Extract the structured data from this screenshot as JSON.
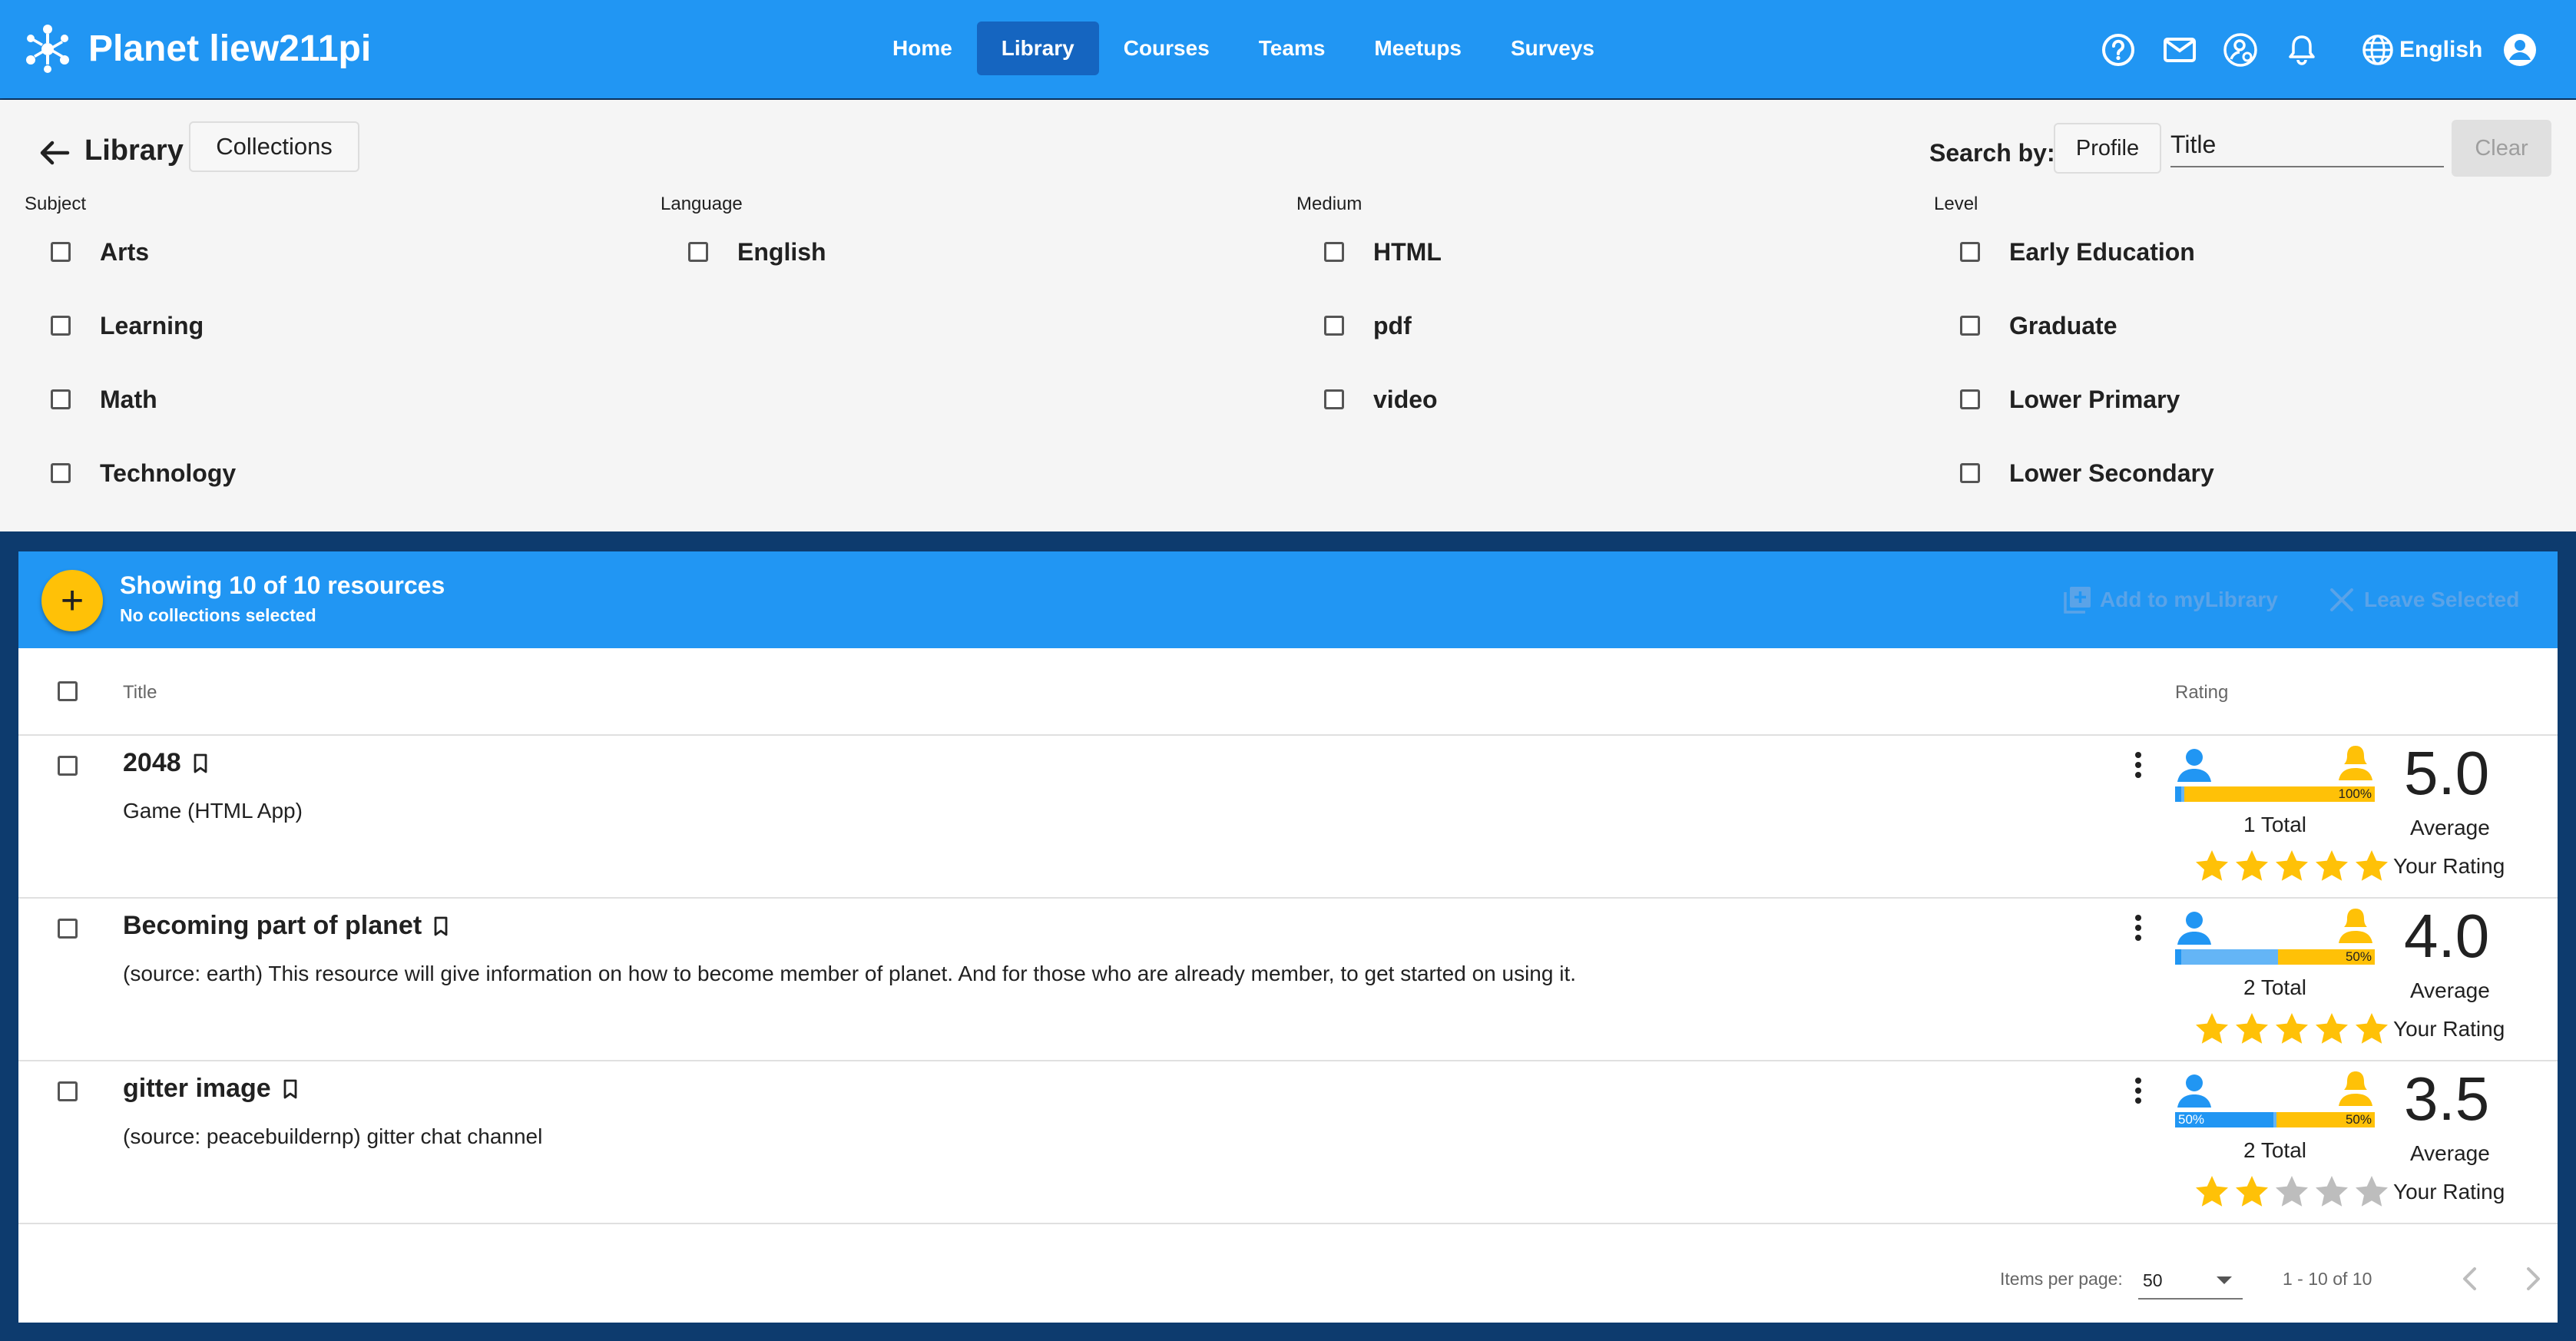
{
  "app": {
    "brand": "Planet liew211pi",
    "nav": [
      {
        "label": "Home",
        "active": false
      },
      {
        "label": "Library",
        "active": true
      },
      {
        "label": "Courses",
        "active": false
      },
      {
        "label": "Teams",
        "active": false
      },
      {
        "label": "Meetups",
        "active": false
      },
      {
        "label": "Surveys",
        "active": false
      }
    ],
    "language": "English",
    "icons": [
      "help-icon",
      "mail-icon",
      "user-settings-icon",
      "bell-icon",
      "globe-icon",
      "account-icon"
    ]
  },
  "library": {
    "title": "Library",
    "collections_button": "Collections",
    "search_by_label": "Search by:",
    "profile_button": "Profile",
    "search_placeholder": "Title",
    "clear_button": "Clear"
  },
  "filters": {
    "subject": {
      "label": "Subject",
      "options": [
        "Arts",
        "Learning",
        "Math",
        "Technology"
      ]
    },
    "language": {
      "label": "Language",
      "options": [
        "English"
      ]
    },
    "medium": {
      "label": "Medium",
      "options": [
        "HTML",
        "pdf",
        "video"
      ]
    },
    "level": {
      "label": "Level",
      "options": [
        "Early Education",
        "Graduate",
        "Lower Primary",
        "Lower Secondary"
      ]
    }
  },
  "results": {
    "showing": "Showing 10 of 10 resources",
    "collections_status": "No collections selected",
    "add_to_mylibrary": "Add to myLibrary",
    "leave_selected": "Leave Selected",
    "columns": {
      "title": "Title",
      "rating": "Rating"
    },
    "rows": [
      {
        "title": "2048",
        "description": "Game (HTML App)",
        "male_percent": 0,
        "female_percent": 100,
        "left_label": "",
        "right_label": "100%",
        "total": "1 Total",
        "average": "5.0",
        "average_label": "Average",
        "your_rating": 5,
        "your_rating_label": "Your Rating"
      },
      {
        "title": "Becoming part of planet",
        "description": "(source: earth) This resource will give information on how to become member of planet. And for those who are already member, to get started on using it.",
        "male_percent": 0,
        "female_percent": 50,
        "left_label": "",
        "right_label": "50%",
        "total": "2 Total",
        "average": "4.0",
        "average_label": "Average",
        "your_rating": 5,
        "your_rating_label": "Your Rating"
      },
      {
        "title": "gitter image",
        "description": "(source: peacebuildernp) gitter chat channel",
        "male_percent": 50,
        "female_percent": 50,
        "left_label": "50%",
        "right_label": "50%",
        "total": "2 Total",
        "average": "3.5",
        "average_label": "Average",
        "your_rating": 2,
        "your_rating_label": "Your Rating"
      }
    ]
  },
  "pagination": {
    "items_per_page_label": "Items per page:",
    "items_per_page": "50",
    "range": "1 - 10 of 10"
  },
  "colors": {
    "primary": "#2196f3",
    "primary_dark": "#1565c0",
    "accent": "#ffc107",
    "star_empty": "#bdbdbd"
  }
}
